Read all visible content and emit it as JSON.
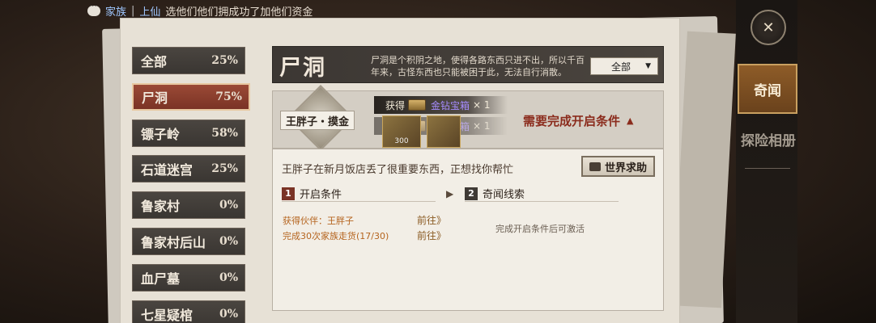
{
  "chat": {
    "channel": "家族",
    "separator": "|",
    "user": "上仙",
    "message": "选他们他们拥成功了加他们资金"
  },
  "sidebar": {
    "items": [
      {
        "label": "全部",
        "percent": "25%",
        "active": false
      },
      {
        "label": "尸洞",
        "percent": "75%",
        "active": true
      },
      {
        "label": "镖子岭",
        "percent": "58%",
        "active": false
      },
      {
        "label": "石道迷宫",
        "percent": "25%",
        "active": false
      },
      {
        "label": "鲁家村",
        "percent": "0%",
        "active": false
      },
      {
        "label": "鲁家村后山",
        "percent": "0%",
        "active": false
      },
      {
        "label": "血尸墓",
        "percent": "0%",
        "active": false
      },
      {
        "label": "七星疑棺",
        "percent": "0%",
        "active": false
      }
    ]
  },
  "header": {
    "title": "尸洞",
    "description": "尸洞是个积阴之地，使得各路东西只进不出，所以千百年来，古怪东西也只能被困于此，无法自行消散。",
    "filter_selected": "全部"
  },
  "quest": {
    "npc": "王胖子・摸金",
    "reward_label": "获得",
    "reward_name": "金钻宝箱",
    "reward_qty": "× 1",
    "reward_label_2": "获得",
    "reward_name_2": "金钻宝箱",
    "reward_qty_2": "× 1",
    "thumb_count": "300",
    "requirement": "需要完成开启条件",
    "text": "王胖子在新月饭店丢了很重要东西，正想找你帮忙",
    "help_button": "世界求助",
    "section1_num": "1",
    "section1_title": "开启条件",
    "section2_num": "2",
    "section2_title": "奇闻线索",
    "conditions": [
      {
        "text": "获得伙伴：王胖子",
        "action": "前往》"
      },
      {
        "text": "完成30次家族走货(17/30)",
        "action": "前往》"
      }
    ],
    "locked_note": "完成开启条件后可激活"
  },
  "right_tabs": {
    "active": "奇闻",
    "album": "探险相册"
  },
  "icons": {
    "chat": "chat-bubble-icon",
    "compass": "compass-icon",
    "help": "chat-icon",
    "chest": "treasure-chest-icon"
  }
}
